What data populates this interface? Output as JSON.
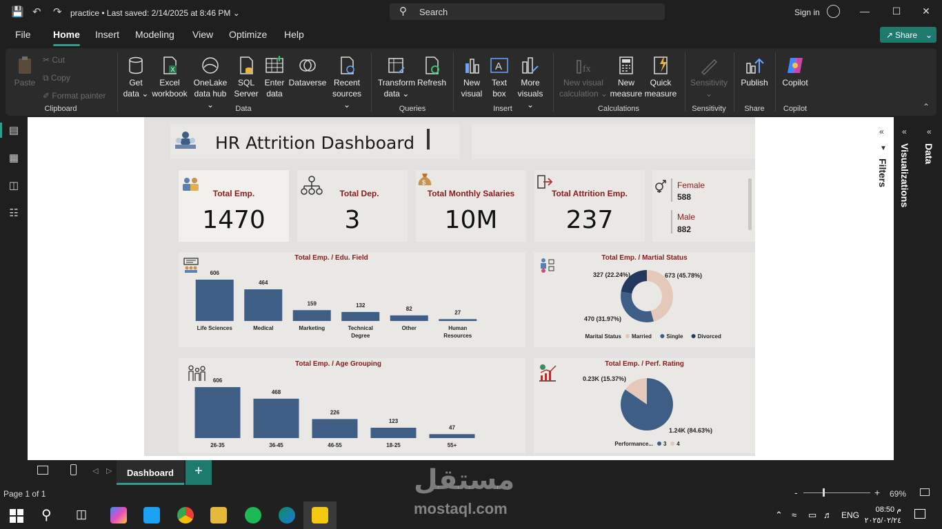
{
  "titlebar": {
    "file": "practice",
    "saved": "Last saved: 2/14/2025 at 8:46 PM",
    "search": "Search",
    "signin": "Sign in"
  },
  "menu": {
    "items": [
      "File",
      "Home",
      "Insert",
      "Modeling",
      "View",
      "Optimize",
      "Help"
    ],
    "share": "Share"
  },
  "ribbon": {
    "clipboard": {
      "paste": "Paste",
      "cut": "Cut",
      "copy": "Copy",
      "format_painter": "Format painter",
      "group": "Clipboard"
    },
    "data": {
      "get1": "Get",
      "get2": "data",
      "excel1": "Excel",
      "excel2": "workbook",
      "onelake1": "OneLake",
      "onelake2": "data hub",
      "sql1": "SQL",
      "sql2": "Server",
      "enter1": "Enter",
      "enter2": "data",
      "dataverse": "Dataverse",
      "recent1": "Recent",
      "recent2": "sources",
      "group": "Data"
    },
    "queries": {
      "transform1": "Transform",
      "transform2": "data",
      "refresh": "Refresh",
      "group": "Queries"
    },
    "insert": {
      "newvisual1": "New",
      "newvisual2": "visual",
      "textbox1": "Text",
      "textbox2": "box",
      "more1": "More",
      "more2": "visuals",
      "group": "Insert"
    },
    "calc": {
      "newcalc1": "New visual",
      "newcalc2": "calculation",
      "newmeasure1": "New",
      "newmeasure2": "measure",
      "quick1": "Quick",
      "quick2": "measure",
      "group": "Calculations"
    },
    "sensitivity": {
      "label": "Sensitivity",
      "group": "Sensitivity"
    },
    "share": {
      "publish": "Publish",
      "group": "Share"
    },
    "copilot": {
      "label": "Copilot",
      "group": "Copilot"
    }
  },
  "report": {
    "title": "HR Attrition Dashboard",
    "kpis": [
      {
        "label": "Total Emp.",
        "value": "1470"
      },
      {
        "label": "Total Dep.",
        "value": "3"
      },
      {
        "label": "Total Monthly Salaries",
        "value": "10M"
      },
      {
        "label": "Total Attrition Emp.",
        "value": "237"
      }
    ],
    "gender": {
      "female_label": "Female",
      "female": "588",
      "male_label": "Male",
      "male": "882"
    }
  },
  "chart_data": [
    {
      "type": "bar",
      "title": "Total Emp. / Edu. Field",
      "categories": [
        "Life Sciences",
        "Medical",
        "Marketing",
        "Technical Degree",
        "Other",
        "Human Resources"
      ],
      "values": [
        606,
        464,
        159,
        132,
        82,
        27
      ]
    },
    {
      "type": "pie",
      "title": "Total Emp. / Martial Status",
      "legend_title": "Marital Status",
      "categories": [
        "Married",
        "Single",
        "Divorced"
      ],
      "values": [
        673,
        470,
        327
      ],
      "labels": [
        "673 (45.78%)",
        "470 (31.97%)",
        "327 (22.24%)"
      ],
      "colors": [
        "#e4c8b9",
        "#3f5e85",
        "#22385e"
      ]
    },
    {
      "type": "bar",
      "title": "Total Emp. / Age Grouping",
      "categories": [
        "26-35",
        "36-45",
        "46-55",
        "18-25",
        "55+"
      ],
      "values": [
        606,
        468,
        226,
        123,
        47
      ]
    },
    {
      "type": "pie",
      "title": "Total Emp. / Perf. Rating",
      "legend_title": "Performance...",
      "categories": [
        "3",
        "4"
      ],
      "values": [
        1244,
        226
      ],
      "labels": [
        "1.24K (84.63%)",
        "0.23K (15.37%)"
      ],
      "colors": [
        "#3f5e85",
        "#e4c8b9"
      ]
    }
  ],
  "panes": {
    "filters": "Filters",
    "visualizations": "Visualizations",
    "data": "Data"
  },
  "bottom": {
    "tab": "Dashboard",
    "page": "Page 1 of 1",
    "zoom": "69%"
  },
  "taskbar": {
    "lang": "ENG",
    "time": "08:50 م",
    "date": "٢٠٢٥/٠٢/٢٤"
  },
  "watermark": {
    "ar": "مستقل",
    "en": "mostaql.com"
  },
  "colors": {
    "accent": "#2f9e8f",
    "bar": "#3f5e85",
    "title_red": "#8b1a1a"
  }
}
